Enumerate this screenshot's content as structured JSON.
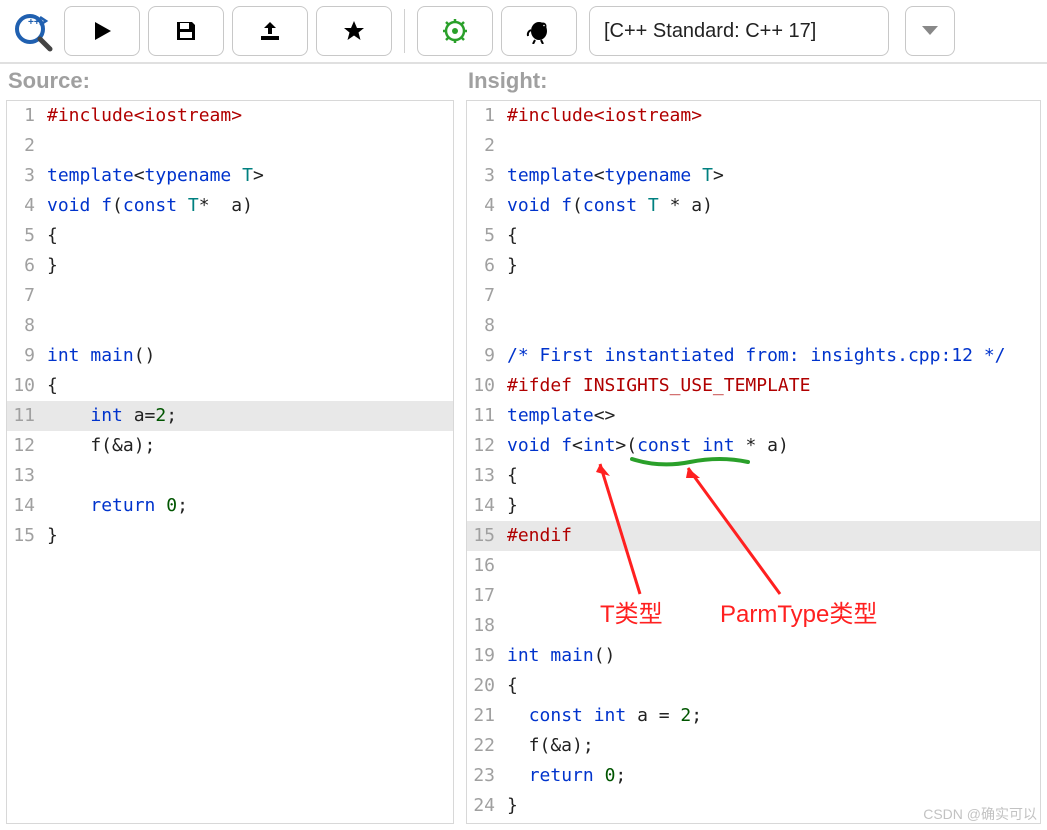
{
  "toolbar": {
    "standard_label": "[C++ Standard: C++ 17]"
  },
  "panes": {
    "source_title": "Source:",
    "insight_title": "Insight:"
  },
  "source_lines": [
    {
      "n": "1",
      "tokens": [
        {
          "t": "#include",
          "c": "pre"
        },
        {
          "t": "<iostream>",
          "c": "str"
        }
      ]
    },
    {
      "n": "2",
      "tokens": []
    },
    {
      "n": "3",
      "tokens": [
        {
          "t": "template",
          "c": "kw"
        },
        {
          "t": "<",
          "c": "pl"
        },
        {
          "t": "typename",
          "c": "kw"
        },
        {
          "t": " ",
          "c": "pl"
        },
        {
          "t": "T",
          "c": "typ"
        },
        {
          "t": ">",
          "c": "pl"
        }
      ]
    },
    {
      "n": "4",
      "tokens": [
        {
          "t": "void",
          "c": "kw"
        },
        {
          "t": " ",
          "c": "pl"
        },
        {
          "t": "f",
          "c": "fn"
        },
        {
          "t": "(",
          "c": "pl"
        },
        {
          "t": "const",
          "c": "kw"
        },
        {
          "t": " ",
          "c": "pl"
        },
        {
          "t": "T",
          "c": "typ"
        },
        {
          "t": "*",
          "c": "pl"
        },
        {
          "t": "  ",
          "c": "pl"
        },
        {
          "t": "a",
          "c": "pl"
        },
        {
          "t": ")",
          "c": "pl"
        }
      ]
    },
    {
      "n": "5",
      "tokens": [
        {
          "t": "{",
          "c": "pl"
        }
      ]
    },
    {
      "n": "6",
      "tokens": [
        {
          "t": "}",
          "c": "pl"
        }
      ]
    },
    {
      "n": "7",
      "tokens": []
    },
    {
      "n": "8",
      "tokens": []
    },
    {
      "n": "9",
      "tokens": [
        {
          "t": "int",
          "c": "kw"
        },
        {
          "t": " ",
          "c": "pl"
        },
        {
          "t": "main",
          "c": "fn"
        },
        {
          "t": "()",
          "c": "pl"
        }
      ]
    },
    {
      "n": "10",
      "tokens": [
        {
          "t": "{",
          "c": "pl"
        }
      ]
    },
    {
      "n": "11",
      "hl": true,
      "tokens": [
        {
          "t": "    ",
          "c": "pl"
        },
        {
          "t": "int",
          "c": "kw"
        },
        {
          "t": " a=",
          "c": "pl"
        },
        {
          "t": "2",
          "c": "num"
        },
        {
          "t": ";",
          "c": "pl"
        }
      ]
    },
    {
      "n": "12",
      "tokens": [
        {
          "t": "    f(&a);",
          "c": "pl"
        }
      ]
    },
    {
      "n": "13",
      "tokens": []
    },
    {
      "n": "14",
      "tokens": [
        {
          "t": "    ",
          "c": "pl"
        },
        {
          "t": "return",
          "c": "kw"
        },
        {
          "t": " ",
          "c": "pl"
        },
        {
          "t": "0",
          "c": "num"
        },
        {
          "t": ";",
          "c": "pl"
        }
      ]
    },
    {
      "n": "15",
      "tokens": [
        {
          "t": "}",
          "c": "pl"
        }
      ]
    }
  ],
  "insight_lines": [
    {
      "n": "1",
      "tokens": [
        {
          "t": "#include",
          "c": "pre"
        },
        {
          "t": "<iostream>",
          "c": "str"
        }
      ]
    },
    {
      "n": "2",
      "tokens": []
    },
    {
      "n": "3",
      "tokens": [
        {
          "t": "template",
          "c": "kw"
        },
        {
          "t": "<",
          "c": "pl"
        },
        {
          "t": "typename",
          "c": "kw"
        },
        {
          "t": " ",
          "c": "pl"
        },
        {
          "t": "T",
          "c": "typ"
        },
        {
          "t": ">",
          "c": "pl"
        }
      ]
    },
    {
      "n": "4",
      "tokens": [
        {
          "t": "void",
          "c": "kw"
        },
        {
          "t": " ",
          "c": "pl"
        },
        {
          "t": "f",
          "c": "fn"
        },
        {
          "t": "(",
          "c": "pl"
        },
        {
          "t": "const",
          "c": "kw"
        },
        {
          "t": " ",
          "c": "pl"
        },
        {
          "t": "T",
          "c": "typ"
        },
        {
          "t": " * a)",
          "c": "pl"
        }
      ]
    },
    {
      "n": "5",
      "tokens": [
        {
          "t": "{",
          "c": "pl"
        }
      ]
    },
    {
      "n": "6",
      "tokens": [
        {
          "t": "}",
          "c": "pl"
        }
      ]
    },
    {
      "n": "7",
      "tokens": []
    },
    {
      "n": "8",
      "tokens": []
    },
    {
      "n": "9",
      "tokens": [
        {
          "t": "/* First instantiated from: insights.cpp:12 */",
          "c": "cm"
        }
      ]
    },
    {
      "n": "10",
      "tokens": [
        {
          "t": "#ifdef",
          "c": "pre"
        },
        {
          "t": " INSIGHTS_USE_TEMPLATE",
          "c": "pre"
        }
      ]
    },
    {
      "n": "11",
      "tokens": [
        {
          "t": "template",
          "c": "kw"
        },
        {
          "t": "<>",
          "c": "pl"
        }
      ]
    },
    {
      "n": "12",
      "tokens": [
        {
          "t": "void",
          "c": "kw"
        },
        {
          "t": " ",
          "c": "pl"
        },
        {
          "t": "f",
          "c": "fn"
        },
        {
          "t": "<",
          "c": "pl"
        },
        {
          "t": "int",
          "c": "kw"
        },
        {
          "t": ">(",
          "c": "pl"
        },
        {
          "t": "const",
          "c": "kw"
        },
        {
          "t": " ",
          "c": "pl"
        },
        {
          "t": "int",
          "c": "kw"
        },
        {
          "t": " * a)",
          "c": "pl"
        }
      ]
    },
    {
      "n": "13",
      "tokens": [
        {
          "t": "{",
          "c": "pl"
        }
      ]
    },
    {
      "n": "14",
      "tokens": [
        {
          "t": "}",
          "c": "pl"
        }
      ]
    },
    {
      "n": "15",
      "hl": true,
      "tokens": [
        {
          "t": "#endif",
          "c": "pre"
        }
      ]
    },
    {
      "n": "16",
      "tokens": []
    },
    {
      "n": "17",
      "tokens": []
    },
    {
      "n": "18",
      "tokens": []
    },
    {
      "n": "19",
      "tokens": [
        {
          "t": "int",
          "c": "kw"
        },
        {
          "t": " ",
          "c": "pl"
        },
        {
          "t": "main",
          "c": "fn"
        },
        {
          "t": "()",
          "c": "pl"
        }
      ]
    },
    {
      "n": "20",
      "tokens": [
        {
          "t": "{",
          "c": "pl"
        }
      ]
    },
    {
      "n": "21",
      "tokens": [
        {
          "t": "  ",
          "c": "pl"
        },
        {
          "t": "const",
          "c": "kw"
        },
        {
          "t": " ",
          "c": "pl"
        },
        {
          "t": "int",
          "c": "kw"
        },
        {
          "t": " a = ",
          "c": "pl"
        },
        {
          "t": "2",
          "c": "num"
        },
        {
          "t": ";",
          "c": "pl"
        }
      ]
    },
    {
      "n": "22",
      "tokens": [
        {
          "t": "  f(&a);",
          "c": "pl"
        }
      ]
    },
    {
      "n": "23",
      "tokens": [
        {
          "t": "  ",
          "c": "pl"
        },
        {
          "t": "return",
          "c": "kw"
        },
        {
          "t": " ",
          "c": "pl"
        },
        {
          "t": "0",
          "c": "num"
        },
        {
          "t": ";",
          "c": "pl"
        }
      ]
    },
    {
      "n": "24",
      "tokens": [
        {
          "t": "}",
          "c": "pl"
        }
      ]
    }
  ],
  "annotations": {
    "label_t": "T类型",
    "label_parm": "ParmType类型"
  },
  "watermark": "CSDN @确实可以"
}
